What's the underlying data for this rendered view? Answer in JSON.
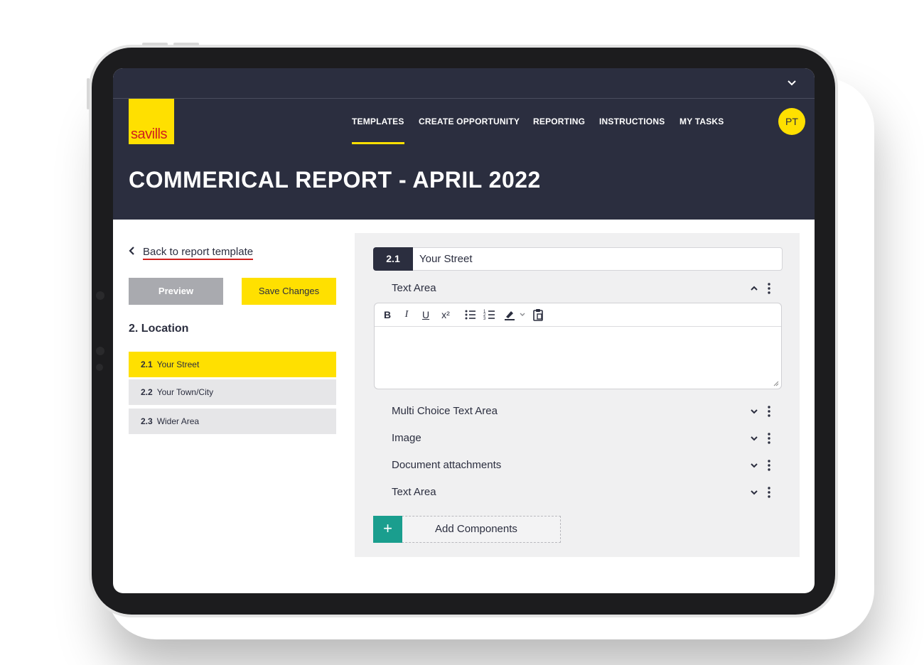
{
  "brand": {
    "logo_text": "savills",
    "logo_color": "#ffe000",
    "logo_text_color": "#d0201d"
  },
  "colors": {
    "header_bg": "#2b2e3f",
    "accent": "#ffe000",
    "add_button": "#1a9e8e"
  },
  "topbar": {
    "expand_icon": "chevron-down-icon"
  },
  "nav": {
    "items": [
      {
        "label": "TEMPLATES",
        "active": true
      },
      {
        "label": "CREATE OPPORTUNITY",
        "active": false
      },
      {
        "label": "REPORTING",
        "active": false
      },
      {
        "label": "INSTRUCTIONS",
        "active": false
      },
      {
        "label": "MY TASKS",
        "active": false
      }
    ]
  },
  "user": {
    "initials": "PT"
  },
  "page": {
    "title": "COMMERICAL REPORT - APRIL 2022"
  },
  "sidebar": {
    "back_label": "Back to report template",
    "preview_label": "Preview",
    "save_label": "Save Changes",
    "section_title": "2. Location",
    "items": [
      {
        "num": "2.1",
        "label": "Your Street",
        "active": true
      },
      {
        "num": "2.2",
        "label": "Your Town/City",
        "active": false
      },
      {
        "num": "2.3",
        "label": "Wider Area",
        "active": false
      }
    ]
  },
  "editor_panel": {
    "field_num": "2.1",
    "field_value": "Your Street",
    "components": [
      {
        "label": "Text Area",
        "expanded": true,
        "icon": "chevron-up-icon"
      },
      {
        "label": "Multi Choice Text Area",
        "expanded": false,
        "icon": "chevron-down-icon"
      },
      {
        "label": "Image",
        "expanded": false,
        "icon": "chevron-down-icon"
      },
      {
        "label": "Document attachments",
        "expanded": false,
        "icon": "chevron-down-icon"
      },
      {
        "label": "Text Area",
        "expanded": false,
        "icon": "chevron-down-icon"
      }
    ],
    "toolbar": {
      "bold": "B",
      "italic": "I",
      "underline": "U",
      "superscript": "x²"
    },
    "add_plus": "+",
    "add_label": "Add Components"
  }
}
